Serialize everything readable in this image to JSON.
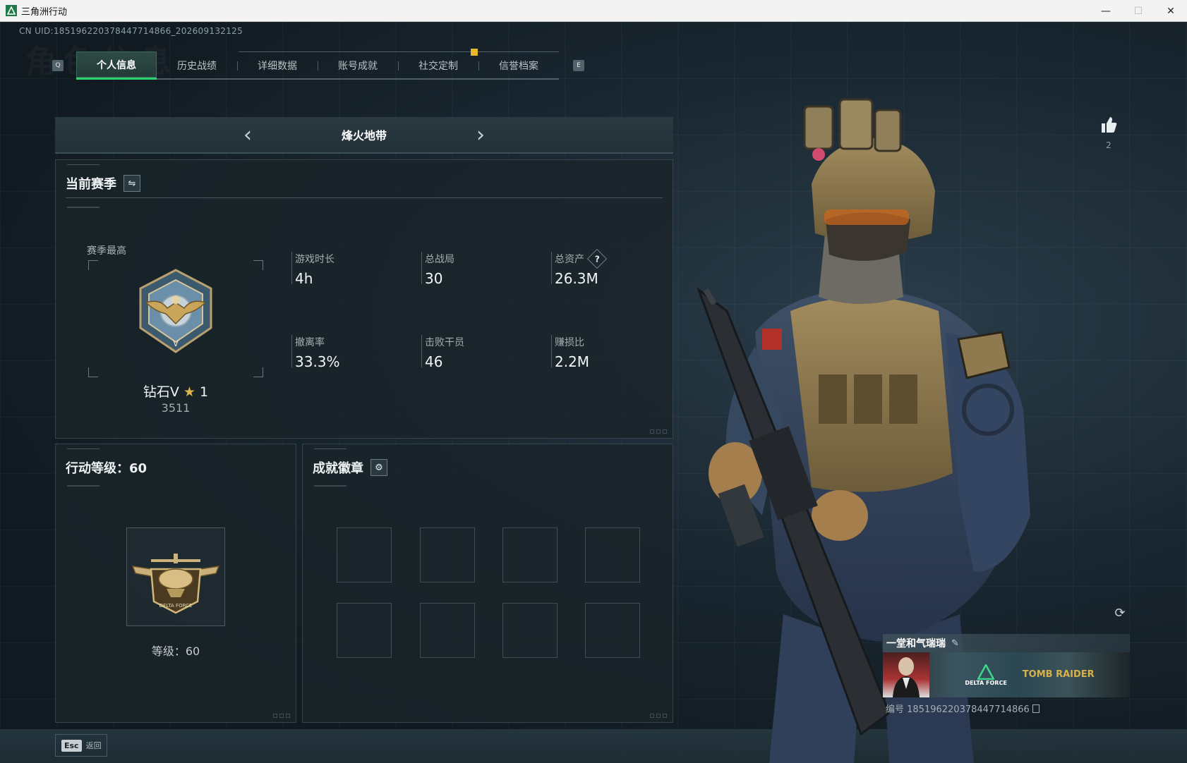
{
  "window": {
    "title": "三角洲行动",
    "controls": [
      "—",
      "☐",
      "✕"
    ]
  },
  "uid_text": "CN UID:1851962203784477148​66_202609132125",
  "tabs": {
    "prev_key": "Q",
    "next_key": "E",
    "items": [
      "个人信息",
      "历史战绩",
      "详细数据",
      "账号成就",
      "社交定制",
      "信誉档案"
    ],
    "active_index": 0
  },
  "mode_selector": {
    "title": "烽火地带",
    "prev_arrow": "‹",
    "next_arrow": "›"
  },
  "season": {
    "title": "当前赛季",
    "swap_icon": "⇋",
    "best_label": "赛季最高",
    "rank_name": "钻石V",
    "rank_star": "★",
    "rank_star_count": "1",
    "rank_score": "3511",
    "stats": [
      {
        "label": "游戏时长",
        "value": "4h"
      },
      {
        "label": "总战局",
        "value": "30"
      },
      {
        "label": "总资产",
        "value": "26.3M",
        "help": "?"
      },
      {
        "label": "撤离率",
        "value": "33.3%"
      },
      {
        "label": "击败干员",
        "value": "46"
      },
      {
        "label": "赚损比",
        "value": "2.2M"
      }
    ]
  },
  "level_panel": {
    "title": "行动等级：60",
    "level_text": "等级：60"
  },
  "badge_panel": {
    "title": "成就徽章",
    "settings_icon": "⚙"
  },
  "like": {
    "count": "2"
  },
  "player_card": {
    "name": "一堂和气瑞瑞",
    "edit_icon": "✎",
    "id_text": "编号 185196220378447714866",
    "banner_logo_left": "DELTA FORCE",
    "banner_logo_right": "TOMB RAIDER"
  },
  "footer": {
    "esc_key": "Esc",
    "esc_label": "返回"
  },
  "colors": {
    "accent_green": "#2ed36f",
    "marker_gold": "#e7b62b",
    "background": "#111a20"
  }
}
